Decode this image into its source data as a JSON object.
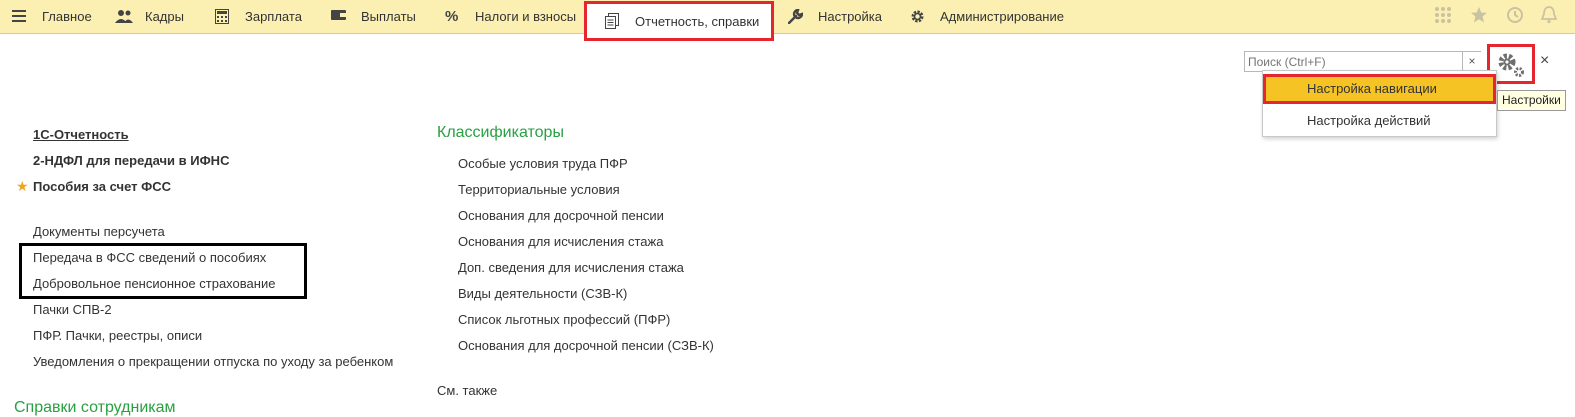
{
  "topbar": {
    "items": [
      {
        "label": "Главное",
        "icon": "menu-icon"
      },
      {
        "label": "Кадры",
        "icon": "people-icon"
      },
      {
        "label": "Зарплата",
        "icon": "calculator-icon"
      },
      {
        "label": "Выплаты",
        "icon": "wallet-icon"
      },
      {
        "label": "Налоги и взносы",
        "icon": "percent-icon",
        "icon_glyph": "%"
      },
      {
        "label": "Отчетность, справки",
        "icon": "documents-icon",
        "active": true
      },
      {
        "label": "Настройка",
        "icon": "wrench-icon"
      },
      {
        "label": "Администрирование",
        "icon": "gear-icon"
      }
    ],
    "right_icons": [
      "apps-grid-icon",
      "star-icon",
      "history-icon",
      "bell-icon"
    ]
  },
  "search": {
    "placeholder": "Поиск (Ctrl+F)",
    "clear": "×"
  },
  "close": "×",
  "settings_menu": {
    "items": [
      "Настройка навигации",
      "Настройка действий"
    ],
    "highlighted": 0,
    "tooltip": "Настройки"
  },
  "left_links": {
    "bold": [
      "1С-Отчетность",
      "2-НДФЛ для передачи в ИФНС",
      "Пособия за счет ФСС"
    ],
    "regular": [
      "Документы персучета",
      "Передача в ФСС сведений о пособиях",
      "Добровольное пенсионное страхование",
      "Пачки СПВ-2",
      "ПФР. Пачки, реестры, описи",
      "Уведомления о прекращении отпуска по уходу за ребенком"
    ],
    "section_title": "Справки сотрудникам"
  },
  "classifiers": {
    "title": "Классификаторы",
    "items": [
      "Особые условия труда ПФР",
      "Территориальные условия",
      "Основания для досрочной пенсии",
      "Основания для исчисления стажа",
      "Доп. сведения для исчисления стажа",
      "Виды деятельности (СЗВ-К)",
      "Список льготных профессий (ПФР)",
      "Основания для досрочной пенсии (СЗВ-К)"
    ],
    "see_also": "См. также"
  },
  "colors": {
    "topbar_bg": "#fbf0b2",
    "section_green": "#2aa043",
    "highlight_red": "#e5262f",
    "menu_highlight": "#f6c324",
    "favorite_star": "#f0a51a"
  }
}
